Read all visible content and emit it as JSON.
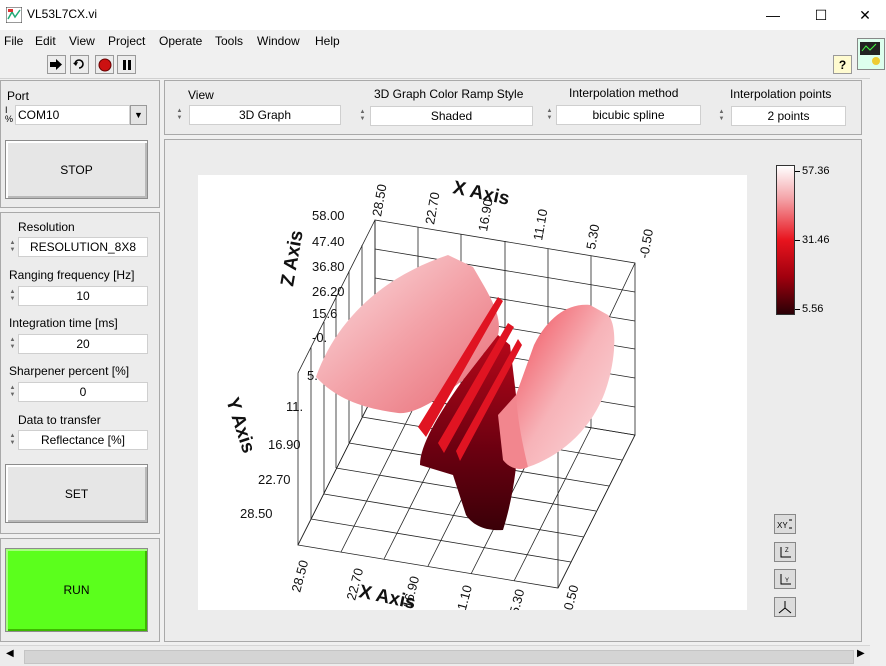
{
  "window": {
    "title": "VL53L7CX.vi",
    "minimize": "—",
    "maximize": "☐",
    "close": "✕"
  },
  "menu": [
    "File",
    "Edit",
    "View",
    "Project",
    "Operate",
    "Tools",
    "Window",
    "Help"
  ],
  "toolbar": {
    "help_icon": "?"
  },
  "port": {
    "label": "Port",
    "value": "COM10"
  },
  "stop_button": "STOP",
  "settings": {
    "resolution": {
      "label": "Resolution",
      "value": "RESOLUTION_8X8"
    },
    "ranging_frequency": {
      "label": "Ranging frequency [Hz]",
      "value": "10"
    },
    "integration_time": {
      "label": "Integration time [ms]",
      "value": "20"
    },
    "sharpener": {
      "label": "Sharpener percent [%]",
      "value": "0"
    },
    "data_to_transfer": {
      "label": "Data to transfer",
      "value": "Reflectance [%]"
    }
  },
  "set_button": "SET",
  "run_button": "RUN",
  "view_controls": {
    "view": {
      "label": "View",
      "value": "3D Graph"
    },
    "color_ramp": {
      "label": "3D Graph Color Ramp Style",
      "value": "Shaded"
    },
    "interp_method": {
      "label": "Interpolation method",
      "value": "bicubic spline"
    },
    "interp_points": {
      "label": "Interpolation points",
      "value": "2 points"
    }
  },
  "graph": {
    "x_axis_title": "X Axis",
    "y_axis_title": "Y Axis",
    "z_axis_title": "Z Axis",
    "x_ticks_top": [
      "28.50",
      "22.70",
      "16.90",
      "11.10",
      "5.30",
      "-0.50"
    ],
    "z_ticks": [
      "58.00",
      "47.40",
      "36.80",
      "26.20",
      "15.6",
      "-0.",
      "5.",
      "11."
    ],
    "y_ticks": [
      "16.90",
      "22.70",
      "28.50"
    ],
    "x_ticks_bottom": [
      "28.50",
      "22.70",
      "16.90",
      "11.10",
      "5.30",
      "-0.50"
    ],
    "ramp_max": "57.36",
    "ramp_mid": "31.46",
    "ramp_min": "5.56",
    "colors": {
      "high": "#ffffff",
      "mid": "#e8141e",
      "low": "#3a0008"
    }
  }
}
